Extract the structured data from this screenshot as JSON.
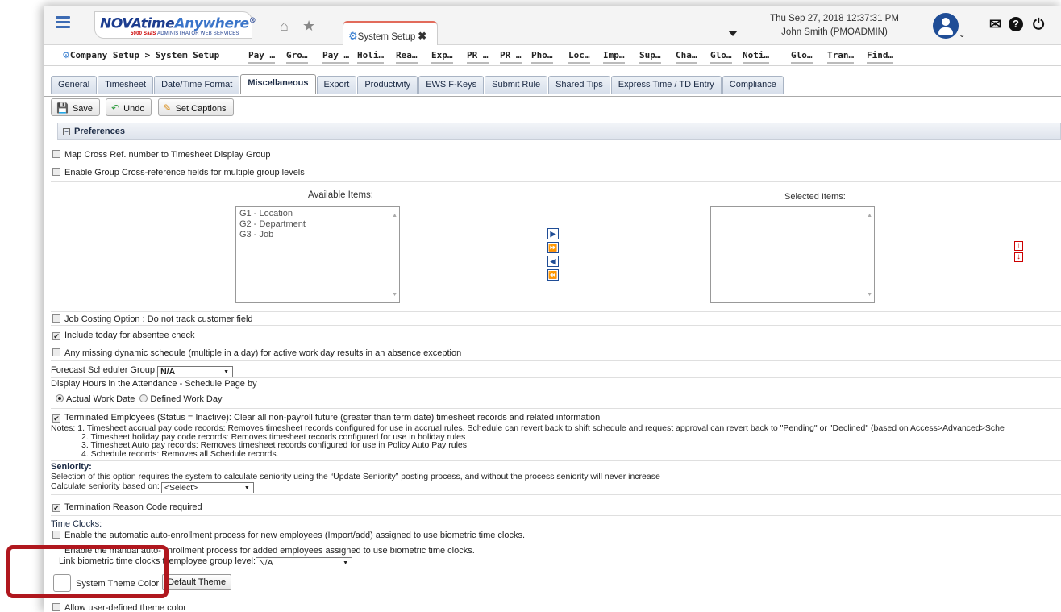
{
  "header": {
    "logo_main": "NOVAtime",
    "logo_any": "Anywhere",
    "logo_reg": "®",
    "logo_sub_num": "5000 SaaS",
    "logo_sub": "ADMINISTRATOR WEB SERVICES",
    "open_tab": "System Setup",
    "datetime": "Thu Sep 27, 2018 12:37:31 PM",
    "user": "John Smith (PMOADMIN)"
  },
  "breadcrumb": "Company Setup > System Setup",
  "quick_links": [
    "Pay …",
    "Gro…",
    "Pay …",
    "Holi…",
    "Rea…",
    "Exp…",
    "PR …",
    "PR …",
    "Pho…",
    "Loc…",
    "Imp…",
    "Sup…",
    "Cha…",
    "Glo…",
    "Noti…",
    "Glo…",
    "Tran…",
    "Find…"
  ],
  "tabs": [
    "General",
    "Timesheet",
    "Date/Time Format",
    "Miscellaneous",
    "Export",
    "Productivity",
    "EWS F-Keys",
    "Submit Rule",
    "Shared Tips",
    "Express Time / TD Entry",
    "Compliance"
  ],
  "active_tab": "Miscellaneous",
  "toolbar": {
    "save": "Save",
    "undo": "Undo",
    "captions": "Set Captions"
  },
  "prefs": {
    "section": "Preferences",
    "map_cross_ref": "Map Cross Ref. number to Timesheet Display Group",
    "enable_group_xref": "Enable Group Cross-reference fields for multiple group levels",
    "available_label": "Available Items:",
    "selected_label": "Selected Items:",
    "available_items": [
      "G1 - Location",
      "G2 - Department",
      "G3 - Job"
    ],
    "job_costing": "Job Costing Option : Do not track customer field",
    "include_today": "Include today for absentee check",
    "missing_schedule": "Any missing dynamic schedule (multiple in a day) for active work day results in an absence exception",
    "forecast_label": "Forecast Scheduler Group:",
    "forecast_value": "N/A",
    "display_hours": "Display Hours in the Attendance - Schedule Page by",
    "radio_actual": "Actual Work Date",
    "radio_defined": "Defined Work Day",
    "terminated": "Terminated Employees (Status = Inactive): Clear all non-payroll future (greater than term date) timesheet records and related information",
    "notes": [
      "Notes: 1. Timesheet accrual pay code records: Removes timesheet records configured for use in accrual rules. Schedule can revert back to shift schedule and request approval can revert back to \"Pending\" or \"Declined\" (based on Access>Advanced>Sche",
      "2. Timesheet holiday pay code records: Removes timesheet records configured for use in holiday rules",
      "3. Timesheet Auto pay records: Removes timesheet records configured for use in Policy Auto Pay rules",
      "4. Schedule records: Removes all Schedule records."
    ],
    "seniority_title": "Seniority:",
    "seniority_desc": "Selection of this option requires the system to calculate seniority using the “Update Seniority” posting process, and without the process seniority will never increase",
    "calc_seniority": "Calculate seniority based on:",
    "calc_seniority_value": "<Select>",
    "termination_reason": "Termination Reason Code required",
    "time_clocks": "Time Clocks:",
    "auto_enroll": "Enable the automatic auto-enrollment process for new employees (Import/add) assigned to use biometric time clocks.",
    "manual_enroll_a": "Enable the manual auto-",
    "manual_enroll_b": "nrollment process for added employees assigned to use biometric time clocks.",
    "link_bio_a": "Link biometric time clocks t",
    "link_bio_b": "employee group level:",
    "link_bio_value": "N/A",
    "theme_color": "System Theme Color",
    "default_theme": "Default Theme",
    "allow_theme": "Allow user-defined theme color"
  },
  "colors": {
    "accent": "#1f4d96",
    "highlight": "#b0171e"
  }
}
